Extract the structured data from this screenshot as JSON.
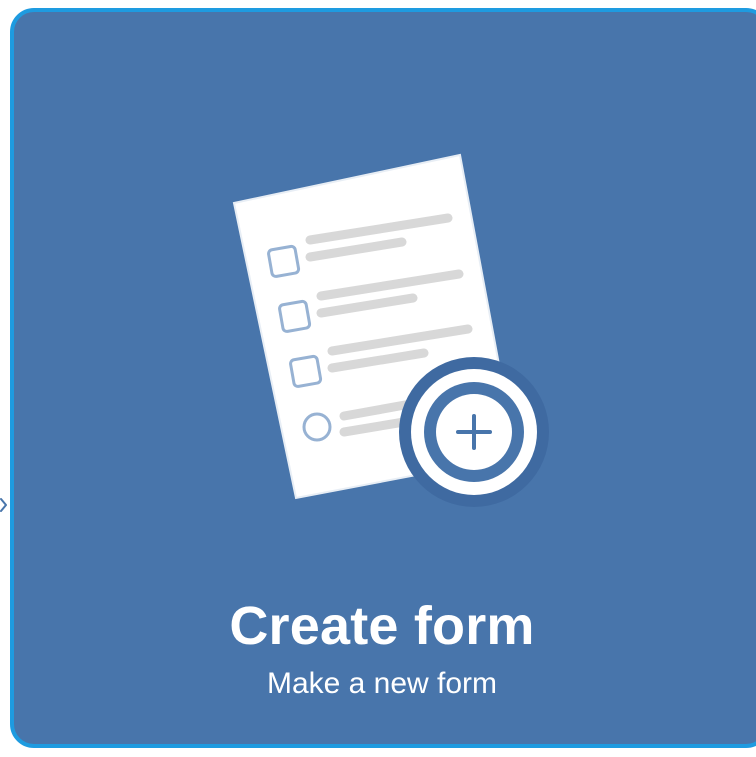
{
  "card": {
    "title": "Create form",
    "subtitle": "Make a new form"
  },
  "icons": {
    "illustration": "form-document-icon",
    "add": "plus-circle-icon",
    "edge": "chevron-right-icon"
  },
  "colors": {
    "card_background": "#4875ab",
    "card_border": "#1e9be0",
    "text": "#ffffff"
  }
}
